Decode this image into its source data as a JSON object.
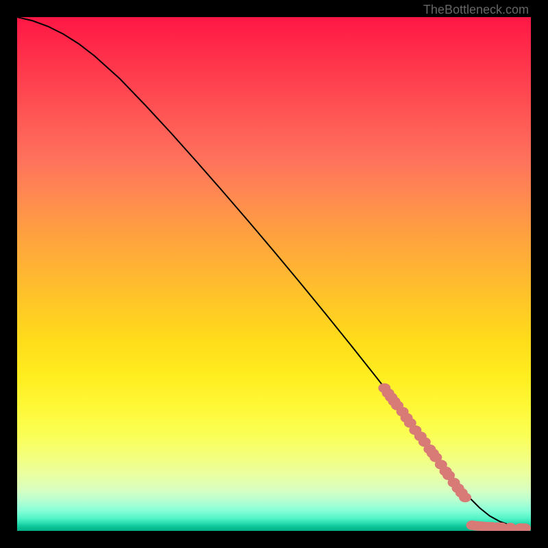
{
  "credit": "TheBottleneck.com",
  "colors": {
    "background": "#000000",
    "line": "#000000",
    "marker": "#d87b77"
  },
  "chart_data": {
    "type": "line",
    "title": "",
    "xlabel": "",
    "ylabel": "",
    "xlim": [
      0,
      100
    ],
    "ylim": [
      0,
      100
    ],
    "series": [
      {
        "name": "curve",
        "x": [
          0,
          3,
          6,
          9,
          12,
          15,
          20,
          25,
          30,
          35,
          40,
          45,
          50,
          55,
          60,
          65,
          70,
          75,
          80,
          82,
          84,
          86,
          88,
          90,
          92,
          94,
          96,
          98,
          100
        ],
        "y": [
          100,
          99.3,
          98.2,
          96.7,
          94.8,
          92.5,
          88,
          82.8,
          77.4,
          71.8,
          66.1,
          60.3,
          54.4,
          48.4,
          42.3,
          36.1,
          29.8,
          23.4,
          16.9,
          14.3,
          11.6,
          8.9,
          6.5,
          4.5,
          2.9,
          1.8,
          1.1,
          0.7,
          0.5
        ]
      }
    ],
    "markers": [
      {
        "x": 71.5,
        "y": 27.8
      },
      {
        "x": 72.2,
        "y": 26.8
      },
      {
        "x": 72.8,
        "y": 26.0
      },
      {
        "x": 73.4,
        "y": 25.2
      },
      {
        "x": 74.0,
        "y": 24.4
      },
      {
        "x": 75.0,
        "y": 23.2
      },
      {
        "x": 75.8,
        "y": 22.0
      },
      {
        "x": 76.5,
        "y": 21.0
      },
      {
        "x": 77.5,
        "y": 19.6
      },
      {
        "x": 78.5,
        "y": 18.4
      },
      {
        "x": 79.3,
        "y": 17.3
      },
      {
        "x": 80.3,
        "y": 15.9
      },
      {
        "x": 80.9,
        "y": 15.1
      },
      {
        "x": 81.5,
        "y": 14.3
      },
      {
        "x": 82.5,
        "y": 12.9
      },
      {
        "x": 83.4,
        "y": 11.6
      },
      {
        "x": 84.0,
        "y": 10.8
      },
      {
        "x": 85.0,
        "y": 9.4
      },
      {
        "x": 85.8,
        "y": 8.3
      },
      {
        "x": 86.5,
        "y": 7.4
      },
      {
        "x": 87.2,
        "y": 6.5
      },
      {
        "x": 88.6,
        "y": 1.1
      },
      {
        "x": 89.2,
        "y": 1.0
      },
      {
        "x": 89.8,
        "y": 0.95
      },
      {
        "x": 90.4,
        "y": 0.9
      },
      {
        "x": 91.0,
        "y": 0.85
      },
      {
        "x": 91.7,
        "y": 0.82
      },
      {
        "x": 92.4,
        "y": 0.79
      },
      {
        "x": 93.6,
        "y": 0.73
      },
      {
        "x": 94.3,
        "y": 0.7
      },
      {
        "x": 96.0,
        "y": 0.63
      },
      {
        "x": 98.0,
        "y": 0.55
      },
      {
        "x": 98.8,
        "y": 0.52
      }
    ]
  }
}
